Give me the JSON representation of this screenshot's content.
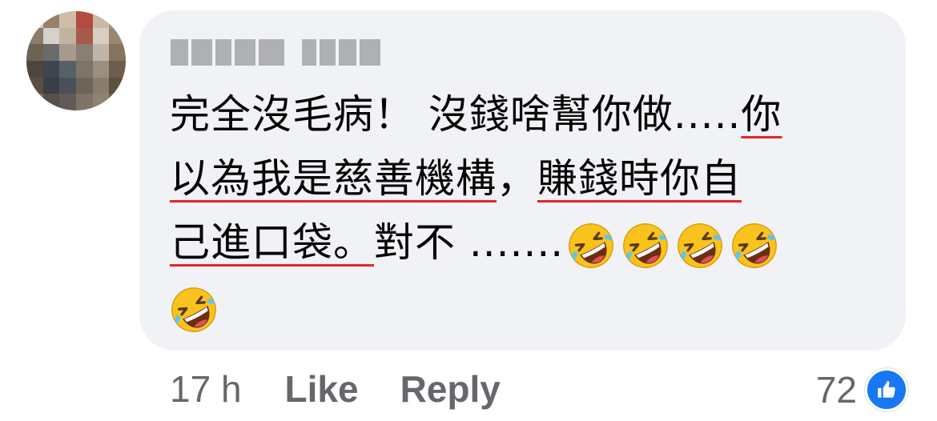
{
  "comment": {
    "author_name": "",
    "lines": [
      {
        "before": "完全沒毛病！ 沒錢啥幫你做.....",
        "underlined": "你",
        "after": ""
      },
      {
        "before": "",
        "underlined": "以為我是慈善機構",
        "middle": "，",
        "underlined2": "賺錢時你自"
      },
      {
        "before": "",
        "underlined": "己進口袋。",
        "after": "對不 ......."
      }
    ],
    "emoji_name": "rolling-on-the-floor-laughing-icon",
    "emoji_count": 5
  },
  "actions": {
    "time": "17 h",
    "like_label": "Like",
    "reply_label": "Reply"
  },
  "reactions": {
    "count": "72",
    "icon": "thumbs-up-icon"
  },
  "colors": {
    "bubble": "#f0f2f5",
    "text": "#050505",
    "meta": "#65676b",
    "spellcheck": "#e4242c",
    "like_badge": "#1877f2"
  }
}
